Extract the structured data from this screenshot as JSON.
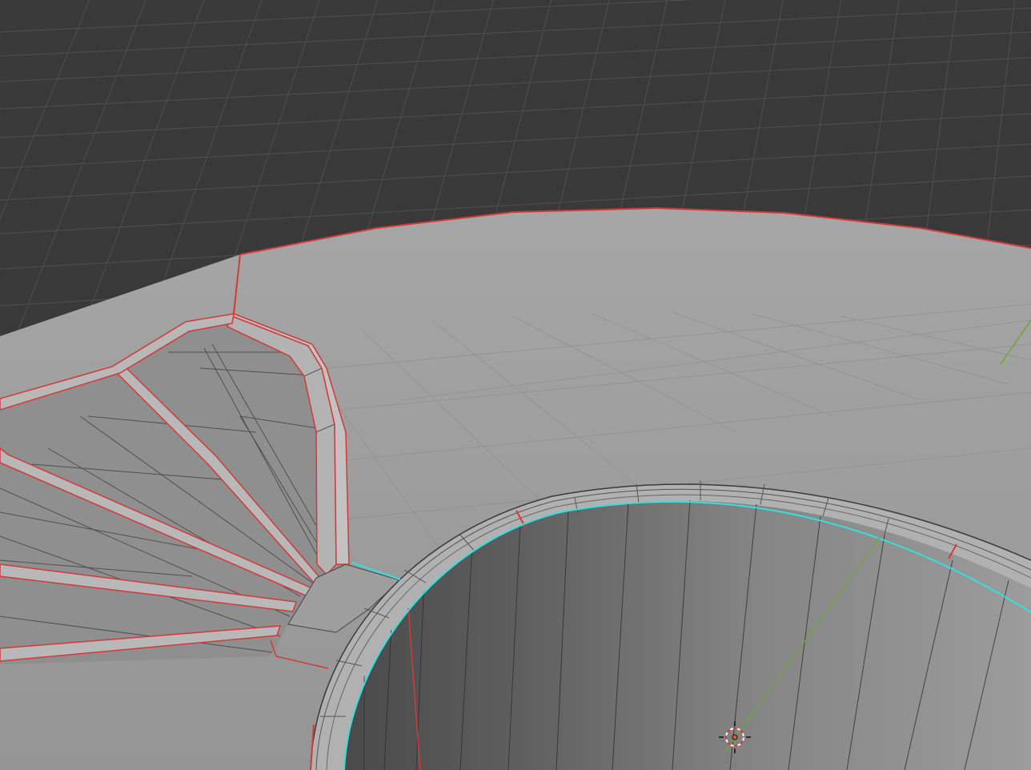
{
  "viewport": {
    "mode": "edit-mode",
    "colors": {
      "background": "#393939",
      "grid": "#4e4e4e",
      "surface": "#9a9a9a",
      "surface_light": "#a3a3a3",
      "hole_wall_dark": "#4d4d4d",
      "hole_wall_light": "#8c8c8c",
      "wire": "#2b2b2b",
      "seam": "#d23a3a",
      "selected_edge": "#32e0e0",
      "y_axis": "#6ea832",
      "cursor": "#e85a1e"
    },
    "icons": [
      "3d-cursor-icon"
    ]
  }
}
